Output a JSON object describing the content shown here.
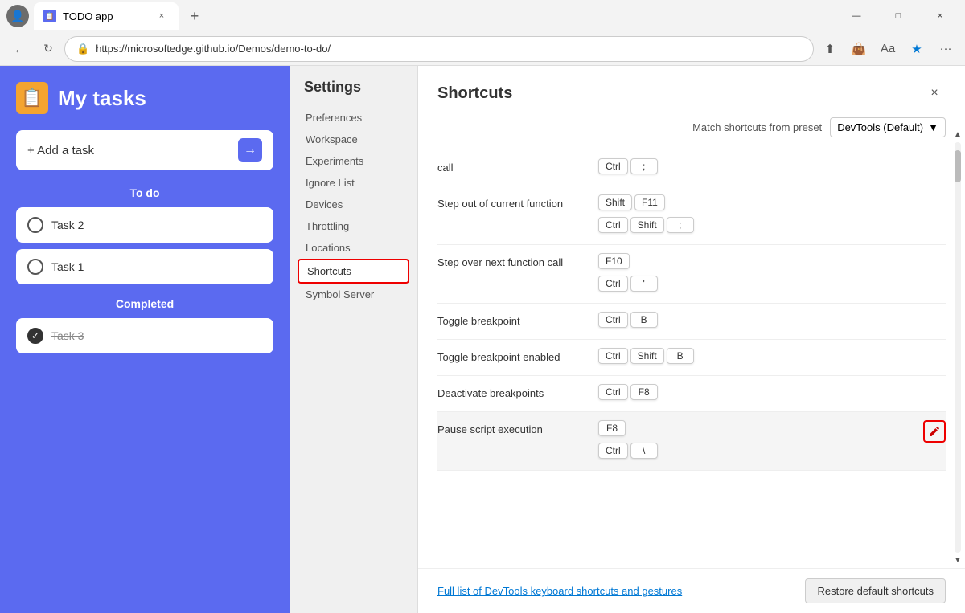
{
  "browser": {
    "tab_title": "TODO app",
    "tab_close": "×",
    "new_tab": "+",
    "url": "https://microsoftedge.github.io/Demos/demo-to-do/",
    "nav_back": "←",
    "nav_refresh": "↻",
    "win_minimize": "—",
    "win_restore": "□",
    "win_close": "×",
    "more_tools": "···"
  },
  "todo": {
    "title": "My tasks",
    "add_placeholder": "+ Add a task",
    "section_todo": "To do",
    "section_completed": "Completed",
    "tasks": [
      {
        "id": "task2",
        "label": "Task 2",
        "completed": false
      },
      {
        "id": "task1",
        "label": "Task 1",
        "completed": false
      }
    ],
    "completed_tasks": [
      {
        "id": "task3",
        "label": "Task 3",
        "completed": true
      }
    ]
  },
  "settings": {
    "title": "Settings",
    "menu_items": [
      {
        "id": "preferences",
        "label": "Preferences",
        "active": false
      },
      {
        "id": "workspace",
        "label": "Workspace",
        "active": false
      },
      {
        "id": "experiments",
        "label": "Experiments",
        "active": false
      },
      {
        "id": "ignore-list",
        "label": "Ignore List",
        "active": false
      },
      {
        "id": "devices",
        "label": "Devices",
        "active": false
      },
      {
        "id": "throttling",
        "label": "Throttling",
        "active": false
      },
      {
        "id": "locations",
        "label": "Locations",
        "active": false
      },
      {
        "id": "shortcuts",
        "label": "Shortcuts",
        "active": true
      },
      {
        "id": "symbol-server",
        "label": "Symbol Server",
        "active": false
      }
    ]
  },
  "shortcuts": {
    "title": "Shortcuts",
    "preset_label": "Match shortcuts from preset",
    "preset_value": "DevTools (Default)",
    "close_icon": "×",
    "items": [
      {
        "id": "call",
        "name": "call",
        "key_groups": [
          [
            "Ctrl",
            ";"
          ]
        ]
      },
      {
        "id": "step-out",
        "name": "Step out of current function",
        "key_groups": [
          [
            "Shift",
            "F11"
          ],
          [
            "Ctrl",
            "Shift",
            ";"
          ]
        ]
      },
      {
        "id": "step-over",
        "name": "Step over next function call",
        "key_groups": [
          [
            "F10"
          ],
          [
            "Ctrl",
            "'"
          ]
        ]
      },
      {
        "id": "toggle-bp",
        "name": "Toggle breakpoint",
        "key_groups": [
          [
            "Ctrl",
            "B"
          ]
        ]
      },
      {
        "id": "toggle-bp-enabled",
        "name": "Toggle breakpoint enabled",
        "key_groups": [
          [
            "Ctrl",
            "Shift",
            "B"
          ]
        ]
      },
      {
        "id": "deactivate-bp",
        "name": "Deactivate breakpoints",
        "key_groups": [
          [
            "Ctrl",
            "F8"
          ]
        ]
      },
      {
        "id": "pause-script",
        "name": "Pause script execution",
        "key_groups": [
          [
            "F8"
          ],
          [
            "Ctrl",
            "\\"
          ]
        ],
        "highlighted": true,
        "has_edit": true
      }
    ],
    "footer_link": "Full list of DevTools keyboard shortcuts and gestures",
    "restore_button": "Restore default shortcuts"
  }
}
